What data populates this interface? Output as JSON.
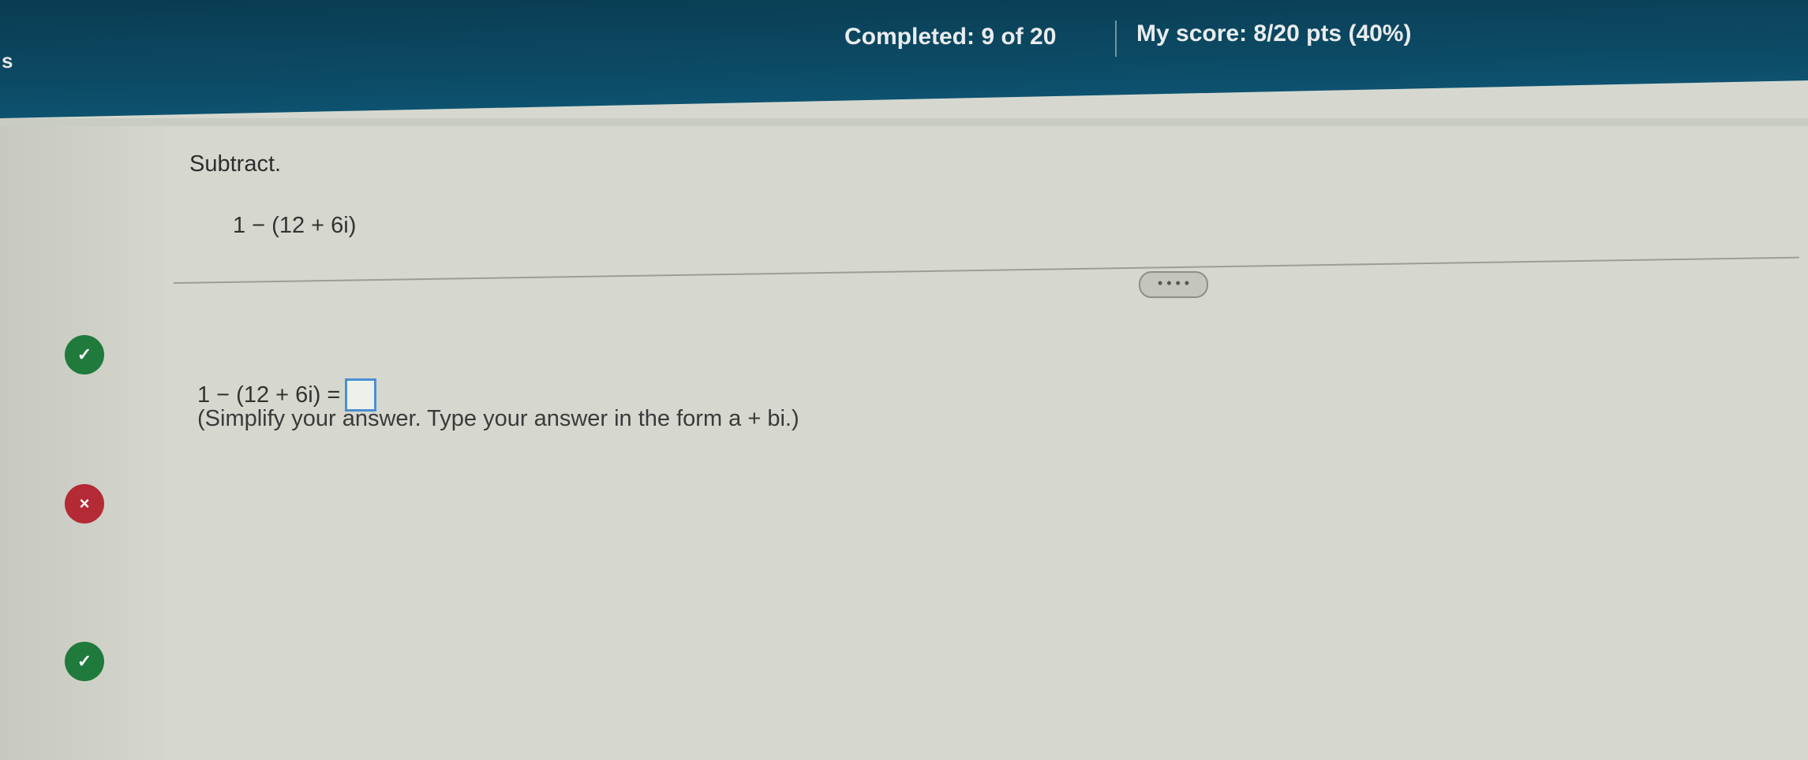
{
  "header": {
    "corner_text": "s",
    "progress": "Completed: 9 of 20",
    "score": "My score: 8/20 pts (40%)"
  },
  "sidebar": {
    "statuses": [
      {
        "state": "correct",
        "icon": "check-icon",
        "symbol": "✓"
      },
      {
        "state": "incorrect",
        "icon": "x-icon",
        "symbol": "×"
      },
      {
        "state": "correct",
        "icon": "check-icon",
        "symbol": "✓"
      }
    ]
  },
  "question": {
    "instruction": "Subtract.",
    "expression": "1 − (12 + 6i)",
    "more_button": "• • • •"
  },
  "answer": {
    "equation_prefix": "1 − (12 + 6i) =",
    "input_value": "",
    "hint": "(Simplify your answer. Type your answer in the form a + bi.)"
  },
  "colors": {
    "header_bg": "#0c4a64",
    "correct": "#1f7a3c",
    "incorrect": "#b42a35",
    "answer_box_border": "#4c8fd1"
  }
}
